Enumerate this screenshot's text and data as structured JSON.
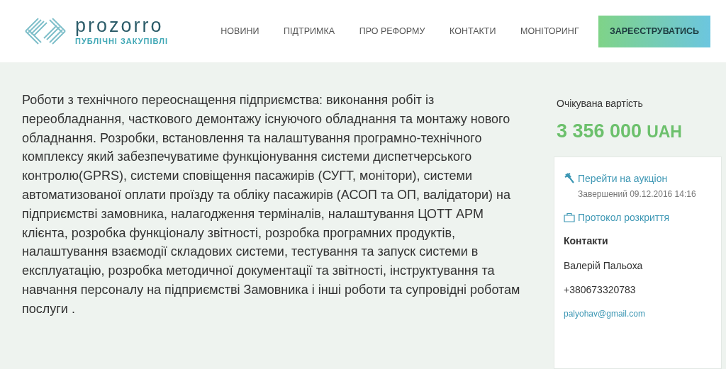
{
  "header": {
    "logo": {
      "name": "prozorro",
      "tagline": "ПУБЛІЧНІ ЗАКУПІВЛІ"
    },
    "nav": [
      "НОВИНИ",
      "ПІДТРИМКА",
      "ПРО РЕФОРМУ",
      "КОНТАКТИ",
      "МОНІТОРИНГ"
    ],
    "register_button": "ЗАРЕЄСТРУВАТИСЬ"
  },
  "tender": {
    "description": "Роботи з технічного переоснащення підприємства: виконання робіт із переобладнання, часткового демонтажу існуючого обладнання та монтажу нового обладнання. Розробки, встановлення та налаштування програмно-технічного комплексу який забезпечуватиме функціонування системи диспетчерського контролю(GPRS), системи сповіщення пасажирів (СУГТ, монітори), системи автоматизованої оплати проїзду та обліку пасажирів (АСОП та ОП, валідатори) на підприємстві замовника, налагодження терміналів, налаштування ЦОТТ АРМ клієнта, розробка функціоналу звітності, розробка програмних продуктів, налаштування взаємодії складових системи, тестування та запуск системи в експлуатацію, розробка методичної документації та звітності, інструктування та навчання персоналу на підприємстві Замовника і інші роботи та супровідні роботам послуги ."
  },
  "sidebar": {
    "value_label": "Очікувана вартість",
    "amount": "3 356 000",
    "currency": "UAH",
    "auction_link": "Перейти на аукціон",
    "auction_status": "Завершений 09.12.2016 14:16",
    "protocol_link": "Протокол розкриття",
    "contacts_heading": "Контакти",
    "contact_name": "Валерій Пальоха",
    "phone": "+380673320783",
    "email": "palyohav@gmail.com"
  }
}
